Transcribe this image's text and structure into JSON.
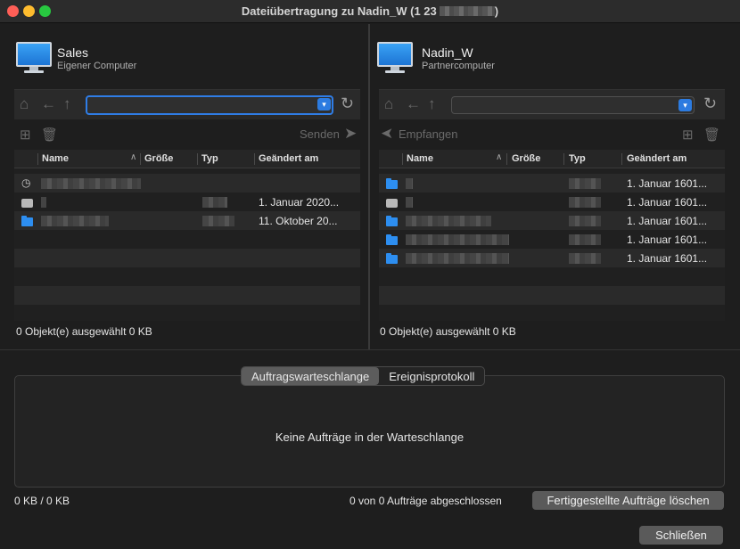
{
  "window": {
    "title": "Dateiübertragung zu Nadin_W (1 23",
    "title_suffix": ")"
  },
  "left": {
    "computer_name": "Sales",
    "computer_sub": "Eigener Computer",
    "action_label": "Senden",
    "columns": [
      "Name",
      "Größe",
      "Typ",
      "Geändert am"
    ],
    "rows": [
      {
        "icon": "history-icon",
        "date": ""
      },
      {
        "icon": "drive-icon",
        "date": "1. Januar 2020..."
      },
      {
        "icon": "folder-icon",
        "date": "11. Oktober 20..."
      }
    ],
    "status": "0 Objekt(e) ausgewählt  0 KB"
  },
  "right": {
    "computer_name": "Nadin_W",
    "computer_sub": "Partnercomputer",
    "action_label": "Empfangen",
    "columns": [
      "Name",
      "Größe",
      "Typ",
      "Geändert am"
    ],
    "rows": [
      {
        "icon": "folder-icon",
        "date": "1. Januar 1601..."
      },
      {
        "icon": "drive-icon",
        "date": "1. Januar 1601..."
      },
      {
        "icon": "folder-icon",
        "date": "1. Januar 1601..."
      },
      {
        "icon": "folder-icon",
        "date": "1. Januar 1601..."
      },
      {
        "icon": "folder-icon",
        "date": "1. Januar 1601..."
      }
    ],
    "status": "0 Objekt(e) ausgewählt  0 KB"
  },
  "bottom": {
    "tabs": [
      "Auftragswarteschlange",
      "Ereignisprotokoll"
    ],
    "active_tab": "Auftragswarteschlange",
    "empty_text": "Keine Aufträge in der Warteschlange",
    "size_text": "0 KB / 0 KB",
    "done_text": "0 von 0 Aufträge abgeschlossen",
    "clear_button": "Fertiggestellte Aufträge löschen",
    "close_button": "Schließen"
  },
  "colors": {
    "accent": "#2c7be0",
    "folder": "#2d8ef0"
  }
}
